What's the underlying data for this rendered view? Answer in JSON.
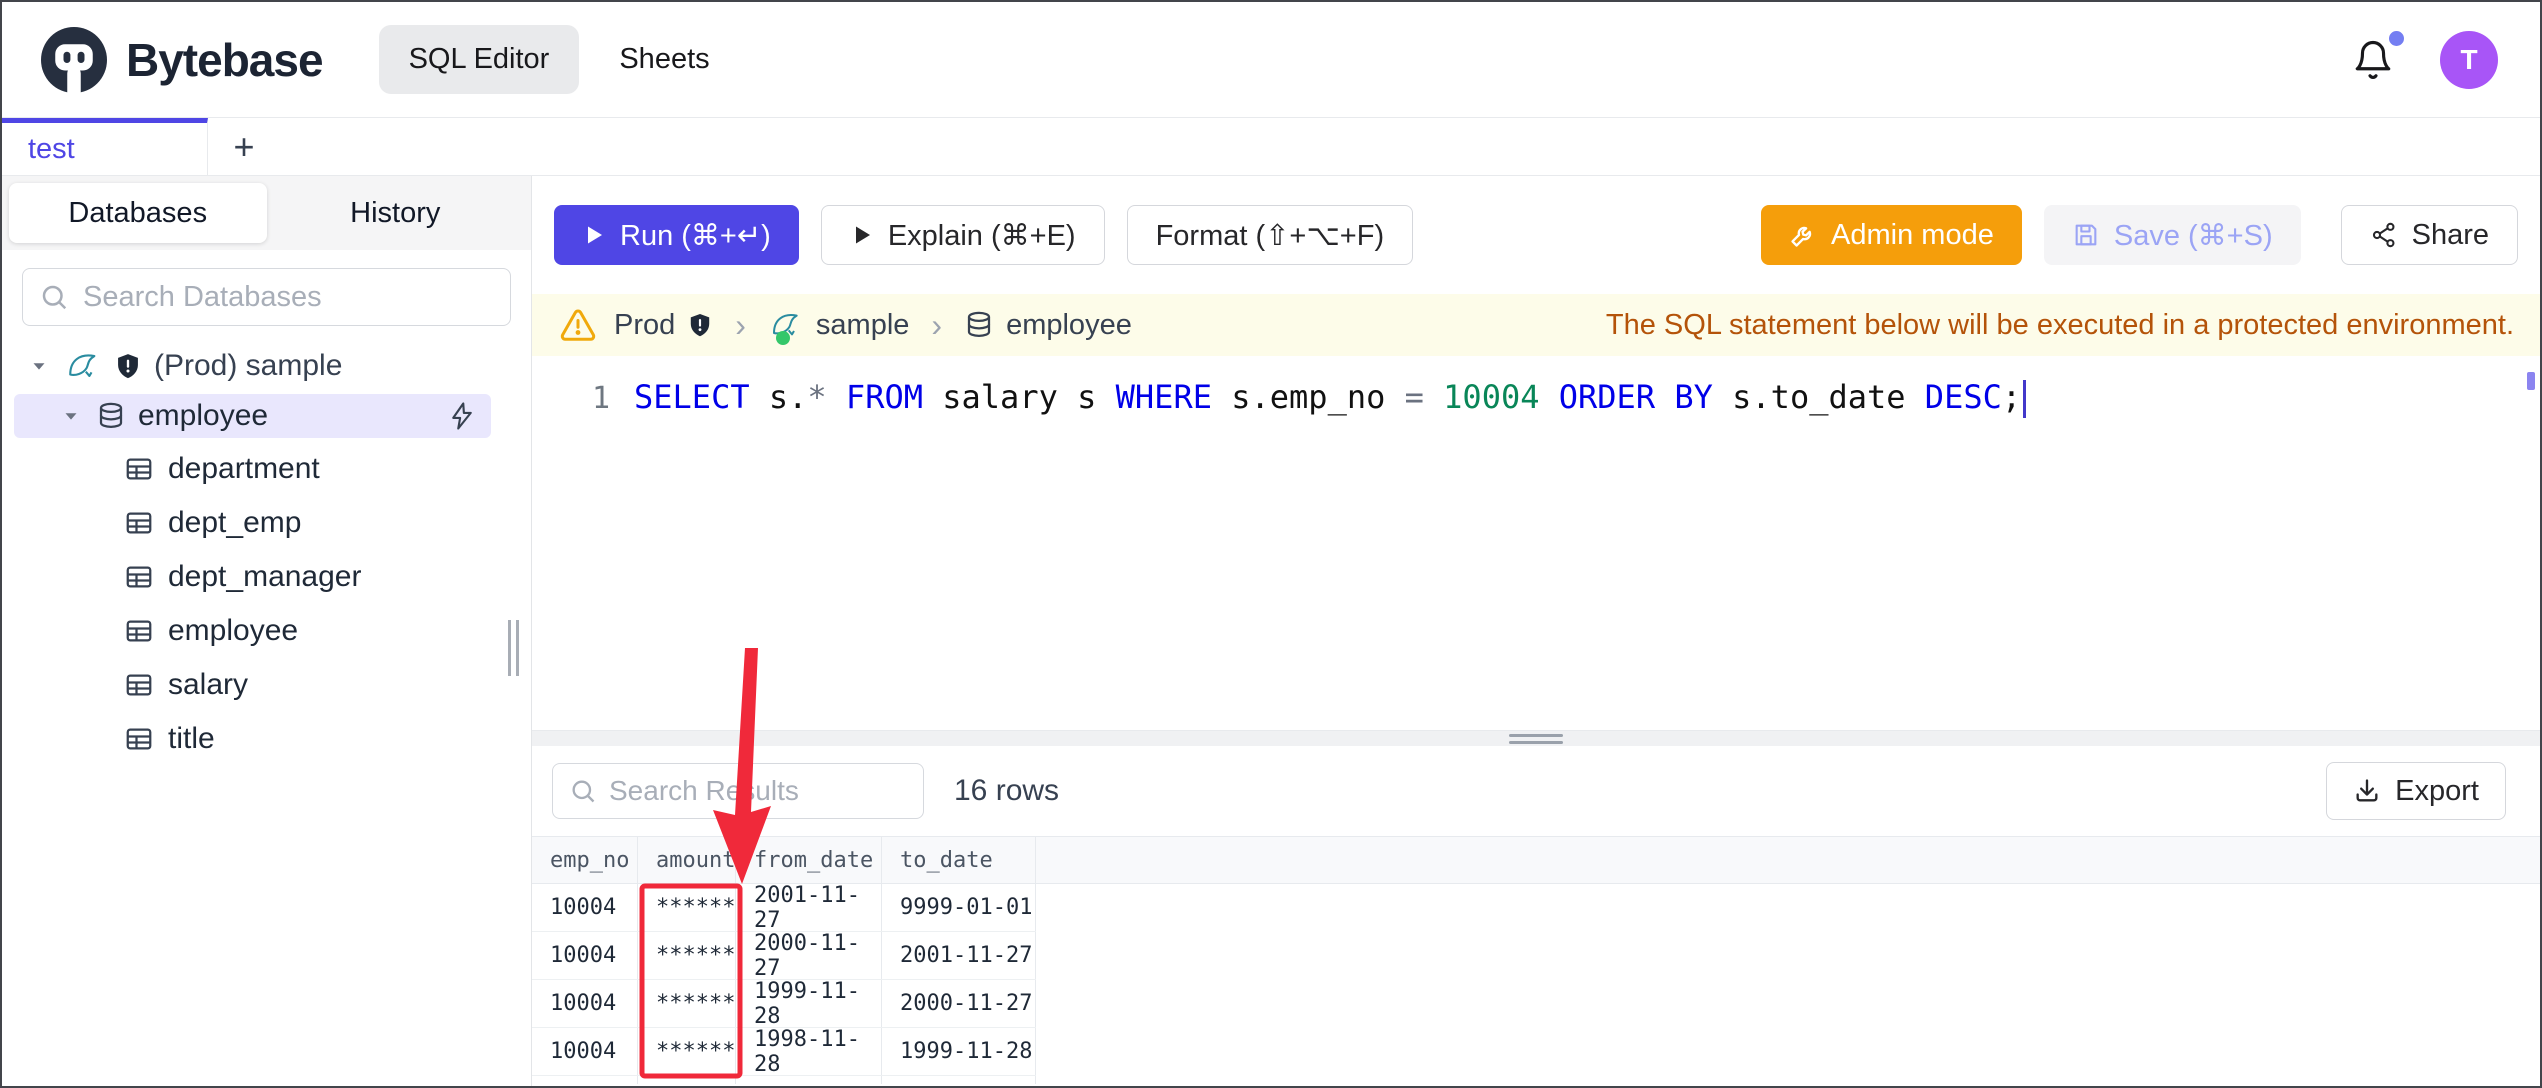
{
  "header": {
    "brand": "Bytebase",
    "nav": {
      "sql_editor": "SQL Editor",
      "sheets": "Sheets"
    },
    "avatar_initial": "T"
  },
  "tabs": {
    "active": "test",
    "new_tab": "+"
  },
  "sidebar": {
    "tabs": {
      "databases": "Databases",
      "history": "History"
    },
    "search_placeholder": "Search Databases",
    "tree": {
      "instance": "(Prod) sample",
      "database": "employee",
      "tables": [
        "department",
        "dept_emp",
        "dept_manager",
        "employee",
        "salary",
        "title"
      ]
    }
  },
  "toolbar": {
    "run": "Run (⌘+↵)",
    "explain": "Explain (⌘+E)",
    "format": "Format (⇧+⌥+F)",
    "admin_mode": "Admin mode",
    "save": "Save (⌘+S)",
    "share": "Share"
  },
  "notice": {
    "environment": "Prod",
    "database": "sample",
    "table": "employee",
    "separator": "›",
    "message": "The SQL statement below will be executed in a protected environment."
  },
  "editor": {
    "line_number": "1",
    "tokens": {
      "select": "SELECT",
      "t1": " s.",
      "star": "*",
      "sp1": " ",
      "from": "FROM",
      "t2": " salary s ",
      "where": "WHERE",
      "t3": " s.emp_no ",
      "eq": "=",
      "sp2": " ",
      "num": "10004",
      "sp3": " ",
      "order_by": "ORDER BY",
      "t4": " s.to_date ",
      "desc": "DESC",
      "semi": ";"
    }
  },
  "results": {
    "search_placeholder": "Search Results",
    "row_count": "16 rows",
    "export": "Export",
    "table": {
      "columns": [
        "emp_no",
        "amount",
        "from_date",
        "to_date"
      ],
      "masked_column": "amount",
      "rows": [
        [
          "10004",
          "******",
          "2001-11-27",
          "9999-01-01"
        ],
        [
          "10004",
          "******",
          "2000-11-27",
          "2001-11-27"
        ],
        [
          "10004",
          "******",
          "1999-11-28",
          "2000-11-27"
        ],
        [
          "10004",
          "******",
          "1998-11-28",
          "1999-11-28"
        ]
      ]
    }
  },
  "colors": {
    "accent": "#4f46e5",
    "admin_orange": "#f59e0b",
    "annotation_red": "#f0293a",
    "notice_bg": "#fdfce9",
    "notice_text": "#b45309",
    "keyword_blue": "#0000e8",
    "number_green": "#098658",
    "avatar_purple": "#a855f7"
  }
}
